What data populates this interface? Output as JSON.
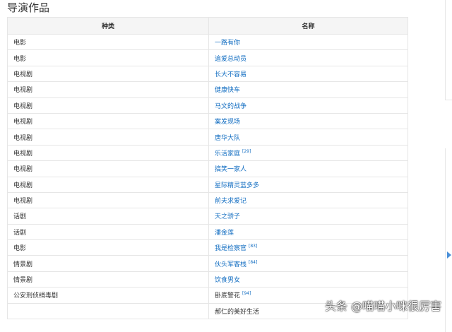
{
  "section_title": "导演作品",
  "headers": [
    "种类",
    "名称"
  ],
  "rows": [
    {
      "type": "电影",
      "name": "一路有你",
      "ref": ""
    },
    {
      "type": "电影",
      "name": "追爱总动员",
      "ref": ""
    },
    {
      "type": "电视剧",
      "name": "长大不容易",
      "ref": ""
    },
    {
      "type": "电视剧",
      "name": "健康快车",
      "ref": ""
    },
    {
      "type": "电视剧",
      "name": "马文的战争",
      "ref": ""
    },
    {
      "type": "电视剧",
      "name": "案发现场",
      "ref": ""
    },
    {
      "type": "电视剧",
      "name": "唐华大队",
      "ref": ""
    },
    {
      "type": "电视剧",
      "name": "乐活家庭",
      "ref": "[29]"
    },
    {
      "type": "电视剧",
      "name": "搞笑一家人",
      "ref": ""
    },
    {
      "type": "电视剧",
      "name": "星际精灵蓝多多",
      "ref": ""
    },
    {
      "type": "电视剧",
      "name": "前夫求爱记",
      "ref": ""
    },
    {
      "type": "话剧",
      "name": "天之骄子",
      "ref": ""
    },
    {
      "type": "话剧",
      "name": "潘金莲",
      "ref": ""
    },
    {
      "type": "电影",
      "name": "我是检察官",
      "ref": "[83]"
    },
    {
      "type": "情景剧",
      "name": "伙头军客栈",
      "ref": "[84]"
    },
    {
      "type": "情景剧",
      "name": "饮食男女",
      "ref": ""
    },
    {
      "type": "公安刑侦缉毒剧",
      "name": "卧底警花",
      "ref": "[94]"
    },
    {
      "type": "",
      "name": "郝仁的美好生活",
      "ref": ""
    }
  ],
  "watermark": "头条 @喵喵小咪很厉害"
}
